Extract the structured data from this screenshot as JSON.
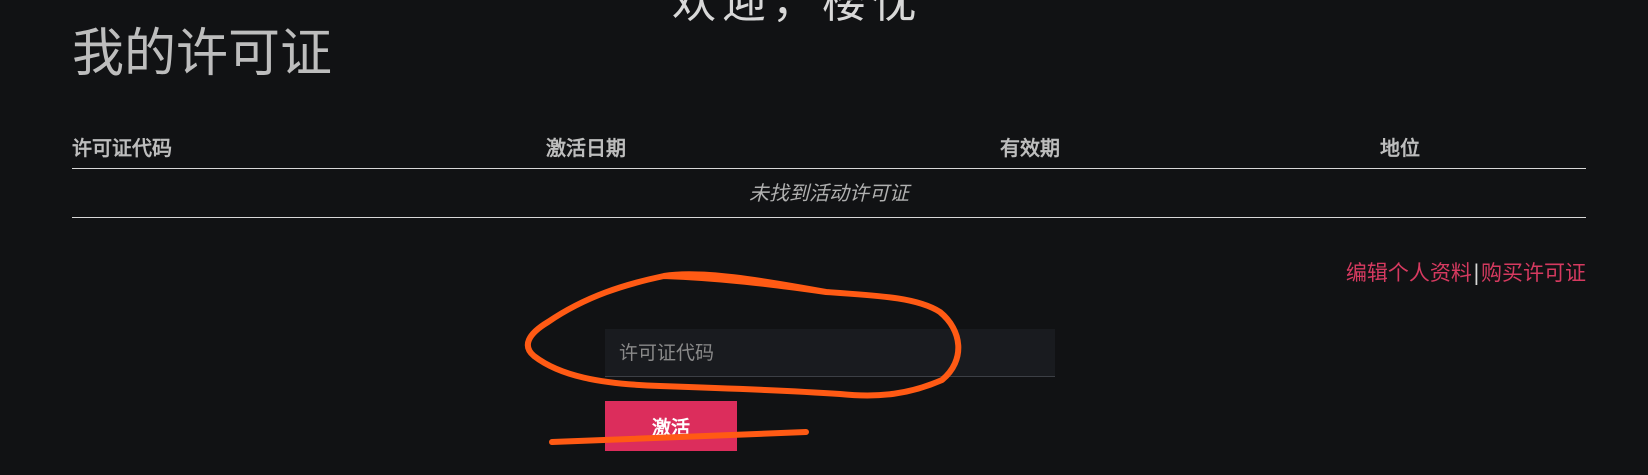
{
  "header": {
    "top_cut_text": "欢迎，楼忱",
    "page_title": "我的许可证"
  },
  "license_table": {
    "columns": [
      "许可证代码",
      "激活日期",
      "有效期",
      "地位"
    ],
    "empty_message": "未找到活动许可证"
  },
  "links": {
    "edit_profile": "编辑个人资料",
    "separator": "|",
    "buy_license": "购买许可证"
  },
  "activation_form": {
    "input_placeholder": "许可证代码",
    "input_value": "",
    "activate_label": "激活"
  },
  "colors": {
    "background": "#111214",
    "accent": "#dc2d5c",
    "link": "#d63a60",
    "annotation": "#ff5a14"
  }
}
